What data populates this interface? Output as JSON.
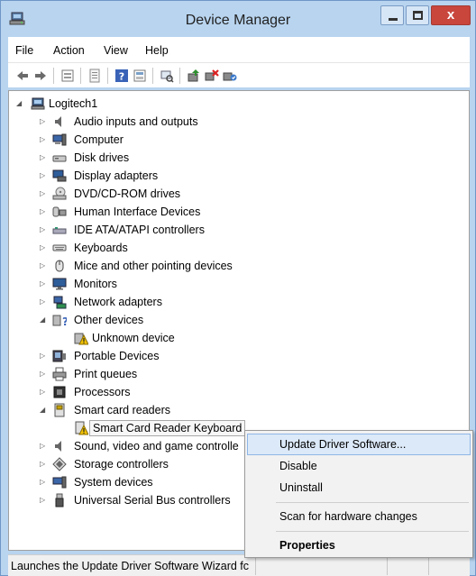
{
  "window": {
    "title": "Device Manager",
    "close_glyph": "x"
  },
  "menu": {
    "items": [
      {
        "label": "File"
      },
      {
        "label": "Action"
      },
      {
        "label": "View"
      },
      {
        "label": "Help"
      }
    ]
  },
  "toolbar": {
    "icons": [
      "back-arrow-icon",
      "forward-arrow-icon",
      "properties-sheet-icon",
      "document-icon",
      "help-icon",
      "view-icon",
      "scan-hardware-icon",
      "update-driver-icon",
      "uninstall-icon",
      "enable-device-icon"
    ]
  },
  "tree": {
    "root": "Logitech1",
    "categories": [
      {
        "label": "Audio inputs and outputs",
        "icon": "speaker-icon",
        "expanded": false
      },
      {
        "label": "Computer",
        "icon": "computer-icon",
        "expanded": false
      },
      {
        "label": "Disk drives",
        "icon": "disk-drive-icon",
        "expanded": false
      },
      {
        "label": "Display adapters",
        "icon": "display-adapter-icon",
        "expanded": false
      },
      {
        "label": "DVD/CD-ROM drives",
        "icon": "dvd-drive-icon",
        "expanded": false
      },
      {
        "label": "Human Interface Devices",
        "icon": "hid-icon",
        "expanded": false
      },
      {
        "label": "IDE ATA/ATAPI controllers",
        "icon": "ide-controller-icon",
        "expanded": false
      },
      {
        "label": "Keyboards",
        "icon": "keyboard-icon",
        "expanded": false
      },
      {
        "label": "Mice and other pointing devices",
        "icon": "mouse-icon",
        "expanded": false
      },
      {
        "label": "Monitors",
        "icon": "monitor-icon",
        "expanded": false
      },
      {
        "label": "Network adapters",
        "icon": "network-adapter-icon",
        "expanded": false
      },
      {
        "label": "Other devices",
        "icon": "other-devices-icon",
        "expanded": true,
        "children": [
          "Unknown device"
        ]
      },
      {
        "label": "Portable Devices",
        "icon": "portable-device-icon",
        "expanded": false
      },
      {
        "label": "Print queues",
        "icon": "printer-icon",
        "expanded": false
      },
      {
        "label": "Processors",
        "icon": "processor-icon",
        "expanded": false
      },
      {
        "label": "Smart card readers",
        "icon": "smart-card-reader-icon",
        "expanded": true,
        "children": [
          "Smart Card Reader Keyboard"
        ]
      },
      {
        "label": "Sound, video and game controlle",
        "icon": "sound-icon",
        "expanded": false
      },
      {
        "label": "Storage controllers",
        "icon": "storage-controller-icon",
        "expanded": false
      },
      {
        "label": "System devices",
        "icon": "system-devices-icon",
        "expanded": false
      },
      {
        "label": "Universal Serial Bus controllers",
        "icon": "usb-icon",
        "expanded": false
      }
    ],
    "selected": "Smart Card Reader Keyboard"
  },
  "context_menu": {
    "items": [
      {
        "label": "Update Driver Software...",
        "highlighted": true
      },
      {
        "label": "Disable"
      },
      {
        "label": "Uninstall"
      },
      {
        "label": "Scan for hardware changes"
      },
      {
        "label": "Properties",
        "bold": true
      }
    ]
  },
  "status": {
    "text": "Launches the Update Driver Software Wizard fc"
  },
  "colors": {
    "frame": "#b8d4ef",
    "close_button": "#c9463d",
    "menu_highlight": "#dce9f8",
    "warning": "#f2c200"
  }
}
